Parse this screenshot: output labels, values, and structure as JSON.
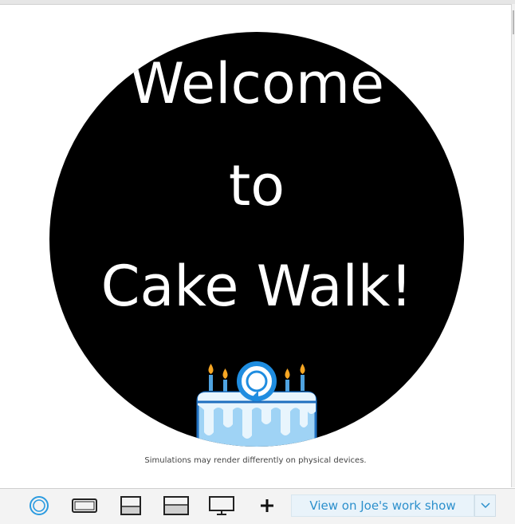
{
  "screen": {
    "welcome_line1": "Welcome",
    "welcome_line2": "to",
    "welcome_line3": "Cake Walk!",
    "background_color": "#000000",
    "text_color": "#ffffff"
  },
  "disclaimer": "Simulations may render differently on physical devices.",
  "toolbar": {
    "devices": [
      {
        "name": "round-device-icon"
      },
      {
        "name": "landscape-device-icon"
      },
      {
        "name": "small-landscape-device-icon"
      },
      {
        "name": "medium-landscape-device-icon"
      },
      {
        "name": "tv-device-icon"
      },
      {
        "name": "add-device-icon"
      }
    ],
    "view_label": "View on Joe's work show",
    "accent_color": "#2b8fcc"
  }
}
